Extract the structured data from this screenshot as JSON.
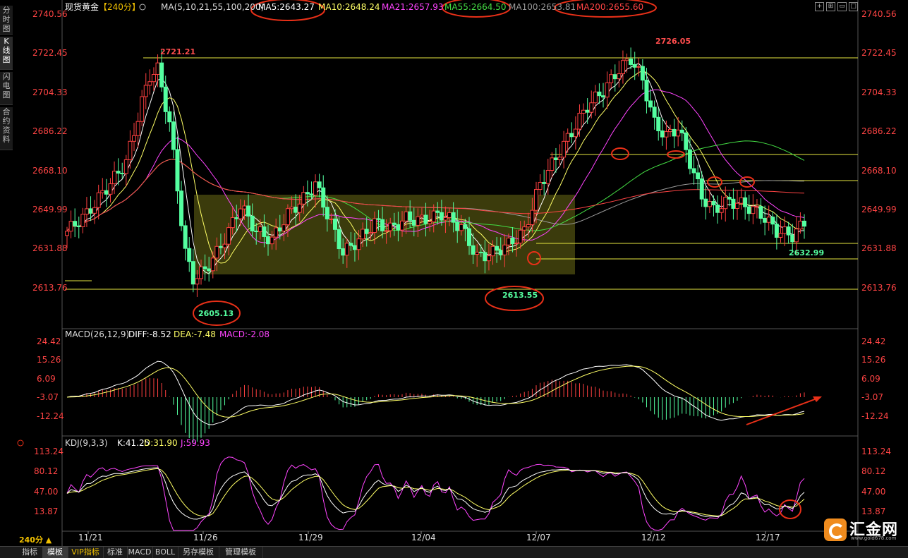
{
  "header": {
    "instrument": "现货黄金",
    "period_tag": "【240分】",
    "ma_params": "MA(5,10,21,55,100,200)",
    "ma5": "MA5:2643.27",
    "ma10": "MA10:2648.24",
    "ma21": "MA21:2657.93",
    "ma55": "MA55:2664.50",
    "ma100": "MA100:2653.81",
    "ma200": "MA200:2655.60"
  },
  "sidebar": {
    "tabs": [
      "分时图",
      "K线图",
      "闪电图",
      "合约资料"
    ],
    "active": 1
  },
  "price_axis": {
    "labels": [
      "2740.56",
      "2722.45",
      "2704.33",
      "2686.22",
      "2668.10",
      "2649.99",
      "2631.88",
      "2613.76"
    ]
  },
  "annotations": {
    "high_left": "2721.21",
    "high_right": "2726.05",
    "low_left": "2605.13",
    "low_mid": "2613.55",
    "last_low": "2632.99"
  },
  "macd": {
    "params": "MACD(26,12,9)",
    "diff": "DIFF:-8.52",
    "dea": "DEA:-7.48",
    "macd": "MACD:-2.08",
    "axis": [
      "24.42",
      "15.26",
      "6.09",
      "-3.07",
      "-12.24"
    ]
  },
  "kdj": {
    "params": "KDJ(9,3,3)",
    "k": "K:41.25",
    "d": "D:31.90",
    "j": "J:59.93",
    "axis": [
      "113.24",
      "80.12",
      "47.00",
      "13.87"
    ]
  },
  "time_axis": {
    "dates": [
      "11/21",
      "11/26",
      "11/29",
      "12/04",
      "12/07",
      "12/12",
      "12/17"
    ]
  },
  "period_indicator": "240分 ▲",
  "bottom_tabs": [
    "指标",
    "模板",
    "VIP指标",
    "标准",
    "MACD",
    "BOLL",
    "另存模板",
    "管理模板"
  ],
  "active_bottom_tab": "模板",
  "logo": {
    "text": "汇金网",
    "url": "www.gold678.com"
  },
  "colors": {
    "up": "#ff4040",
    "down": "#54ffa0",
    "ma5": "#ffffff",
    "ma10": "#ffff66",
    "ma21": "#ff44ff",
    "ma55": "#44dd44",
    "ma100": "#999999",
    "ma200": "#ff4444",
    "axis_text": "#ff4444"
  }
}
